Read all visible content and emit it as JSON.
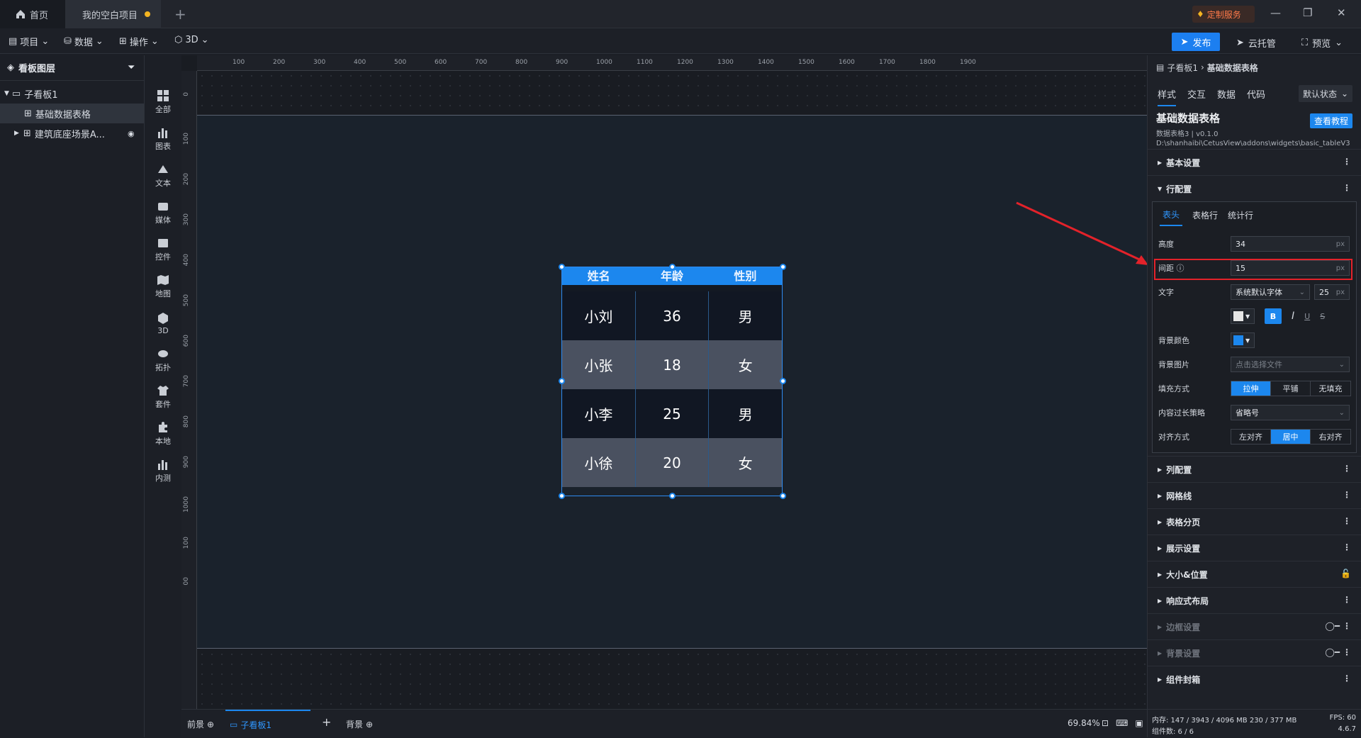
{
  "titlebar": {
    "home": "首页",
    "project": "我的空白项目",
    "custom_service": "定制服务"
  },
  "toolbar": {
    "project": "项目",
    "data": "数据",
    "operate": "操作",
    "three_d": "3D",
    "publish": "发布",
    "cloud": "云托管",
    "preview": "预览"
  },
  "layers": {
    "title": "看板图层",
    "board": "子看板1",
    "item1": "基础数据表格",
    "item2": "建筑底座场景A..."
  },
  "icons": [
    {
      "label": "全部"
    },
    {
      "label": "图表"
    },
    {
      "label": "文本"
    },
    {
      "label": "媒体"
    },
    {
      "label": "控件"
    },
    {
      "label": "地图"
    },
    {
      "label": "3D"
    },
    {
      "label": "拓扑"
    },
    {
      "label": "套件"
    },
    {
      "label": "本地"
    },
    {
      "label": "内测"
    }
  ],
  "ruler": {
    "h": [
      "100",
      "200",
      "300",
      "400",
      "500",
      "600",
      "700",
      "800",
      "900",
      "1000",
      "1100",
      "1200",
      "1300",
      "1400",
      "1500",
      "1600",
      "1700",
      "1800",
      "1900"
    ],
    "v": [
      "0",
      "100",
      "200",
      "300",
      "400",
      "500",
      "600",
      "700",
      "800",
      "900",
      "1000",
      "100",
      "00"
    ]
  },
  "table": {
    "headers": [
      "姓名",
      "年龄",
      "性别"
    ],
    "rows": [
      [
        "小刘",
        "36",
        "男"
      ],
      [
        "小张",
        "18",
        "女"
      ],
      [
        "小李",
        "25",
        "男"
      ],
      [
        "小徐",
        "20",
        "女"
      ]
    ]
  },
  "bottom": {
    "front": "前景",
    "board": "子看板1",
    "back": "背景",
    "zoom": "69.84%"
  },
  "panel": {
    "crumb1": "子看板1",
    "crumb2": "基础数据表格",
    "tabs": [
      "样式",
      "交互",
      "数据",
      "代码"
    ],
    "state": "默认状态",
    "title": "基础数据表格",
    "tutorial": "查看教程",
    "version": "数据表格3 | v0.1.0",
    "path": "D:\\shanhaibi\\CetusView\\addons\\widgets\\basic_tableV3",
    "sec_basic": "基本设置",
    "sec_row": "行配置",
    "subtabs": [
      "表头",
      "表格行",
      "统计行"
    ],
    "height_label": "高度",
    "height_value": "34",
    "gap_label": "间距",
    "gap_value": "15",
    "unit": "px",
    "text_label": "文字",
    "font": "系统默认字体",
    "font_size": "25",
    "bg_color_label": "背景颜色",
    "bg_image_label": "背景图片",
    "bg_image_placeholder": "点击选择文件",
    "fill_label": "填充方式",
    "fill": [
      "拉伸",
      "平铺",
      "无填充"
    ],
    "overflow_label": "内容过长策略",
    "overflow": "省略号",
    "align_label": "对齐方式",
    "align": [
      "左对齐",
      "居中",
      "右对齐"
    ],
    "sections": [
      "列配置",
      "网格线",
      "表格分页",
      "展示设置",
      "大小&位置",
      "响应式布局"
    ],
    "dim_sections": [
      "边框设置",
      "背景设置"
    ],
    "sec_last": "组件封箱",
    "status_mem": "内存: 147 / 3943 / 4096 MB 230 / 377 MB",
    "status_fps": "FPS: 60",
    "status_count": "组件数: 6 / 6",
    "status_ver": "4.6.7"
  }
}
